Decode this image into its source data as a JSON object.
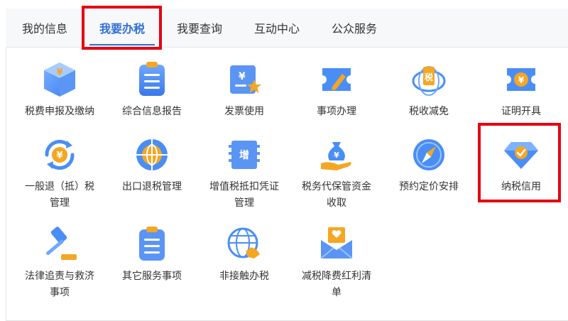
{
  "tabs": [
    {
      "label": "我的信息",
      "active": false
    },
    {
      "label": "我要办税",
      "active": true
    },
    {
      "label": "我要查询",
      "active": false
    },
    {
      "label": "互动中心",
      "active": false
    },
    {
      "label": "公众服务",
      "active": false
    }
  ],
  "colors": {
    "accent": "#2f6fd6",
    "highlight": "#e60012",
    "icon_blue": "#4a8ef5",
    "icon_orange": "#f5a623"
  },
  "items": [
    {
      "label": "税费申报及缴纳",
      "icon": "tax-payment-cube-icon"
    },
    {
      "label": "综合信息报告",
      "icon": "clipboard-report-icon"
    },
    {
      "label": "发票使用",
      "icon": "invoice-star-icon"
    },
    {
      "label": "事项办理",
      "icon": "ticket-edit-icon"
    },
    {
      "label": "税收减免",
      "icon": "tax-reduction-globe-icon"
    },
    {
      "label": "证明开具",
      "icon": "certificate-ticket-icon"
    },
    {
      "label": "一般退（抵）税\n管理",
      "icon": "refund-cycle-icon"
    },
    {
      "label": "出口退税管理",
      "icon": "export-globe-icon"
    },
    {
      "label": "增值税抵扣凭证\n管理",
      "icon": "vat-voucher-icon"
    },
    {
      "label": "税务代保管资金\n收取",
      "icon": "money-bag-hand-icon"
    },
    {
      "label": "预约定价安排",
      "icon": "compass-icon"
    },
    {
      "label": "纳税信用",
      "icon": "diamond-credit-icon"
    },
    {
      "label": "法律追责与救济\n事项",
      "icon": "gavel-icon"
    },
    {
      "label": "其它服务事项",
      "icon": "clipboard-list-icon"
    },
    {
      "label": "非接触办税",
      "icon": "globe-handshake-icon"
    },
    {
      "label": "减税降费红利清\n单",
      "icon": "envelope-heart-icon"
    }
  ]
}
